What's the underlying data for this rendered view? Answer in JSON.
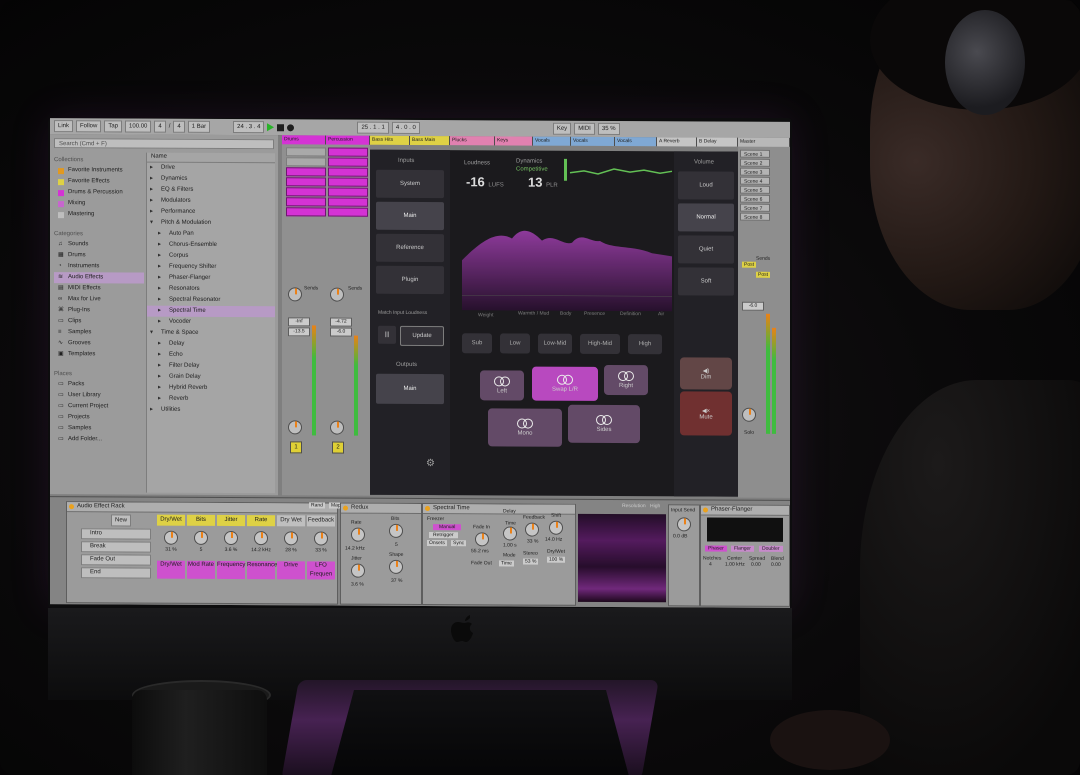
{
  "transport": {
    "link": "Link",
    "follow": "Follow",
    "tap": "Tap",
    "tempo": "100.00",
    "sig_num": "4",
    "sig_den": "4",
    "quant": "1 Bar",
    "position": "24 . 3 . 4",
    "loop_start": "25 . 1 . 1",
    "loop_len": "4 . 0 . 0",
    "key": "Key",
    "midi": "MIDI",
    "cpu": "35 %"
  },
  "browser": {
    "search_placeholder": "Search (Cmd + F)",
    "collections_title": "Collections",
    "collections": [
      {
        "label": "Favorite Instruments",
        "color": "#f5a623"
      },
      {
        "label": "Favorite Effects",
        "color": "#f1e34b"
      },
      {
        "label": "Drums & Percussion",
        "color": "#e637e6"
      },
      {
        "label": "Mixing",
        "color": "#d86fe0"
      },
      {
        "label": "Mastering",
        "color": "#cfcfcf"
      }
    ],
    "categories_title": "Categories",
    "categories": [
      "Sounds",
      "Drums",
      "Instruments",
      "Audio Effects",
      "MIDI Effects",
      "Max for Live",
      "Plug-Ins",
      "Clips",
      "Samples",
      "Grooves",
      "Templates"
    ],
    "places_title": "Places",
    "places": [
      "Packs",
      "User Library",
      "Current Project",
      "Projects",
      "Samples",
      "Add Folder..."
    ],
    "name_header": "Name",
    "folders": [
      {
        "label": "Drive",
        "level": 0
      },
      {
        "label": "Dynamics",
        "level": 0
      },
      {
        "label": "EQ & Filters",
        "level": 0
      },
      {
        "label": "Modulators",
        "level": 0
      },
      {
        "label": "Performance",
        "level": 0
      },
      {
        "label": "Pitch & Modulation",
        "level": 0
      },
      {
        "label": "Auto Pan",
        "level": 1
      },
      {
        "label": "Chorus-Ensemble",
        "level": 1
      },
      {
        "label": "Corpus",
        "level": 1
      },
      {
        "label": "Frequency Shifter",
        "level": 1
      },
      {
        "label": "Phaser-Flanger",
        "level": 1
      },
      {
        "label": "Resonators",
        "level": 1
      },
      {
        "label": "Spectral Resonator",
        "level": 1
      },
      {
        "label": "Spectral Time",
        "level": 1
      },
      {
        "label": "Vocoder",
        "level": 1
      },
      {
        "label": "Time & Space",
        "level": 0
      },
      {
        "label": "Delay",
        "level": 1
      },
      {
        "label": "Echo",
        "level": 1
      },
      {
        "label": "Filter Delay",
        "level": 1
      },
      {
        "label": "Grain Delay",
        "level": 1
      },
      {
        "label": "Hybrid Reverb",
        "level": 1
      },
      {
        "label": "Reverb",
        "level": 1
      },
      {
        "label": "Utilities",
        "level": 0
      }
    ]
  },
  "tracks": {
    "headers": [
      "Drums",
      "Percussion",
      "Bass Hits",
      "Bass Main",
      "Plucks",
      "Keys",
      "Vocals",
      "Vocals",
      "Vocals",
      "A Reverb",
      "B Delay",
      "Master"
    ],
    "sends": "Sends",
    "vol1": "-Inf",
    "vol1b": "-13.5",
    "vol2": "-4.72",
    "vol2b": "-6.0",
    "num1": "1",
    "num2": "2",
    "scenes": [
      "Scene 1",
      "Scene 2",
      "Scene 3",
      "Scene 4",
      "Scene 5",
      "Scene 6",
      "Scene 7",
      "Scene 8"
    ],
    "post": "Post",
    "solo": "Solo"
  },
  "plugin": {
    "inputs_label": "Inputs",
    "inputs": [
      "System",
      "Main",
      "Reference",
      "Plugin"
    ],
    "match_label": "Match Input Loudness",
    "update": "Update",
    "outputs_label": "Outputs",
    "output_main": "Main",
    "loudness_label": "Loudness",
    "loudness_value": "-16",
    "loudness_unit": "LUFS",
    "dynamics_label": "Dynamics",
    "dynamics_sub": "Competitive",
    "dynamics_value": "13",
    "dynamics_unit": "PLR",
    "band_labels": [
      "Weight",
      "Warmth / Mud",
      "Body",
      "Presence",
      "Definition",
      "Air"
    ],
    "freq_buttons": [
      "Sub",
      "Low",
      "Low-Mid",
      "High-Mid",
      "High"
    ],
    "volume_label": "Volume",
    "volume": [
      "Loud",
      "Normal",
      "Quiet",
      "Soft"
    ],
    "stereo": [
      "Left",
      "Swap L/R",
      "Right",
      "Mono",
      "Sides"
    ],
    "dim": "Dim",
    "mute": "Mute"
  },
  "devices": {
    "rack_title": "Audio Effect Rack",
    "new": "New",
    "variations": [
      "Intro",
      "Break",
      "Fade Out",
      "End"
    ],
    "rand": "Rand",
    "map": "Map",
    "macros_top": [
      {
        "label": "Dry/Wet",
        "value": "31 %",
        "color": "y"
      },
      {
        "label": "Bits",
        "value": "5",
        "color": "y"
      },
      {
        "label": "Jitter",
        "value": "3.6 %",
        "color": "y"
      },
      {
        "label": "Rate",
        "value": "14.2 kHz",
        "color": "y"
      },
      {
        "label": "Dry Wet",
        "value": "28 %",
        "color": "n"
      },
      {
        "label": "Feedback",
        "value": "33 %",
        "color": "n"
      }
    ],
    "macros_bottom": [
      "Dry/Wet",
      "Mod Rate",
      "Frequency",
      "Resonance",
      "Drive",
      "LFO Frequen"
    ],
    "redux": {
      "title": "Redux",
      "rate": "Rate",
      "rate_val": "14.2 kHz",
      "bits": "Bits",
      "bits_val": "5",
      "jitter": "Jitter",
      "jitter_val": "3.6 %",
      "shape": "Shape",
      "shape_val": "37 %"
    },
    "spectral": {
      "title": "Spectral Time",
      "freezer": "Freezer",
      "manual": "Manual",
      "retrigger": "Retrigger",
      "onsets": "Onsets",
      "sync": "Sync",
      "fade_in": "Fade In",
      "fade_in_val": "55.2 ms",
      "fade_out": "Fade Out"
    },
    "delay": {
      "title": "Delay",
      "time": "Time",
      "time_val": "1.00 s",
      "feedback": "Feedback",
      "feedback_val": "33 %",
      "shift": "Shift",
      "shift_val": "14.0 Hz",
      "mode": "Mode",
      "mode_val": "Time",
      "stereo": "Stereo",
      "stereo_val": "53 %",
      "drywet": "Dry/Wet",
      "drywet_val": "100 %"
    },
    "resolution": "Resolution",
    "resolution_val": "High",
    "input_send": "Input Send",
    "input_send_val": "0.0 dB",
    "phaser": {
      "title": "Phaser-Flanger",
      "modes": [
        "Phaser",
        "Flanger",
        "Doubler"
      ],
      "notches": "Notches",
      "notches_val": "4",
      "center": "Center",
      "center_val": "1.00 kHz",
      "spread": "Spread",
      "spread_val": "0.00",
      "blend": "Blend",
      "blend_val": "0.00"
    }
  },
  "colors": {
    "accent": "#e637e6",
    "clip_yellow": "#f1e34b",
    "plugin_bg": "#1d1c20",
    "stereo_on": "#c84fd0"
  }
}
